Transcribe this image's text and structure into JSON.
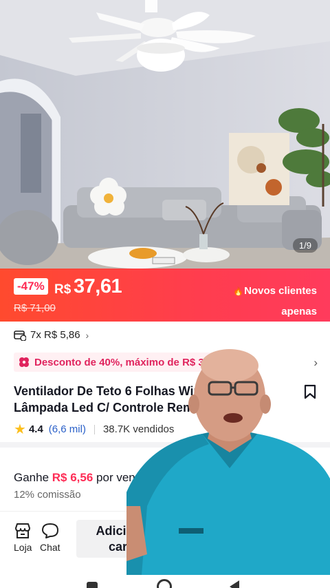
{
  "gallery": {
    "counter": "1/9"
  },
  "price": {
    "discount": "-47%",
    "currency": "R$",
    "value": "37,61",
    "original": "R$ 71,00",
    "promo_line1": "Novos clientes",
    "promo_line2": "apenas"
  },
  "installments": {
    "text": "7x R$ 5,86"
  },
  "coupon": {
    "text": "Desconto de 40%, máximo de R$ 35"
  },
  "product": {
    "title": "Ventilador De Teto 6 Folhas Wind Light Lâmpada Led C/ Controle Remoto Bivolt"
  },
  "rating": {
    "score": "4.4",
    "reviews": "(6,6 mil)",
    "sold": "38.7K vendidos"
  },
  "affiliate": {
    "earn_prefix": "Ganhe ",
    "earn_amount": "R$ 6,56",
    "earn_suffix": " por venda",
    "commission": "12% comissão"
  },
  "actions": {
    "store": "Loja",
    "chat": "Chat",
    "add_cart": "Adicionar ao carrinho"
  },
  "colors": {
    "accent": "#fe2c55",
    "banner_start": "#ff4a2e",
    "banner_end": "#ff3b5c",
    "star": "#fcbf1e",
    "link": "#2a60c8"
  },
  "icons": [
    "store-icon",
    "chat-icon",
    "bookmark-icon",
    "star-icon",
    "installment-icon",
    "coupon-icon",
    "chevron-right-icon"
  ]
}
